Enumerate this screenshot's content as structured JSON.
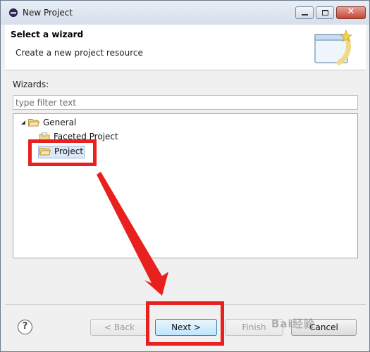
{
  "window": {
    "title": "New Project"
  },
  "banner": {
    "title": "Select a wizard",
    "description": "Create a new project resource"
  },
  "wizards": {
    "label": "Wizards:",
    "filter_placeholder": "type filter text",
    "tree": [
      {
        "label": "General",
        "expanded": true,
        "icon": "folder-open-icon"
      },
      {
        "label": "Faceted Project",
        "icon": "faceted-project-icon"
      },
      {
        "label": "Project",
        "icon": "project-folder-icon",
        "selected": true
      }
    ]
  },
  "buttons": {
    "help": "?",
    "back": "< Back",
    "next": "Next >",
    "finish": "Finish",
    "cancel": "Cancel"
  },
  "watermark": "Bai经验",
  "colors": {
    "annotation": "#e8201e",
    "selection": "#dbe8f7"
  }
}
